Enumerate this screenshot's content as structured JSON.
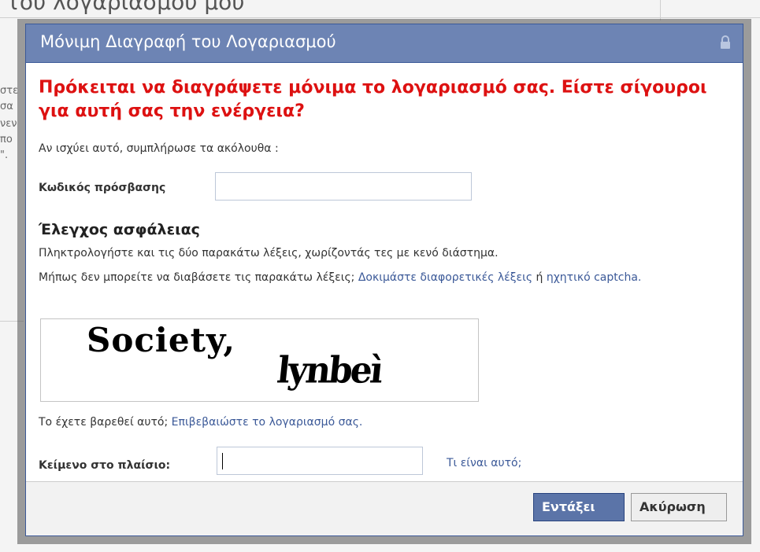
{
  "background": {
    "title": "του λογαριασμού μου",
    "fragments": [
      "στε",
      "σα",
      "νεν",
      "πο",
      "\"."
    ]
  },
  "dialog": {
    "title": "Μόνιμη Διαγραφή του Λογαριασμού",
    "warning": "Πρόκειται να διαγράψετε μόνιμα το λογαριασμό σας. Είστε σίγουροι για αυτή σας την ενέργεια?",
    "intro": "Αν ισχύει αυτό, συμπλήρωσε τα ακόλουθα :",
    "password": {
      "label": "Κωδικός πρόσβασης",
      "value": ""
    },
    "security": {
      "heading": "Έλεγχος ασφάλειας",
      "instruction": "Πληκτρολογήστε και τις δύο παρακάτω λέξεις, χωρίζοντάς τες με κενό διάστημα.",
      "cant_read": "Μήπως δεν μπορείτε να διαβάσετε τις παρακάτω λέξεις;",
      "try_other_link": "Δοκιμάστε διαφορετικές λέξεις",
      "or": "ή",
      "audio_link": "ηχητικό captcha."
    },
    "captcha": {
      "word1": "Society,",
      "word2": "lynbeì"
    },
    "account": {
      "tired": "Το έχετε βαρεθεί αυτό;",
      "verify_link": "Επιβεβαιώστε το λογαριασμό σας."
    },
    "text_box": {
      "label": "Κείμενο στο πλαίσιο:",
      "value": "",
      "help_link": "Τι είναι αυτό;"
    },
    "buttons": {
      "ok": "Εντάξει",
      "cancel": "Ακύρωση"
    }
  },
  "colors": {
    "header": "#6d84b4",
    "warning": "#dd1111",
    "link": "#3b5998",
    "ok_button": "#5b74a8"
  }
}
